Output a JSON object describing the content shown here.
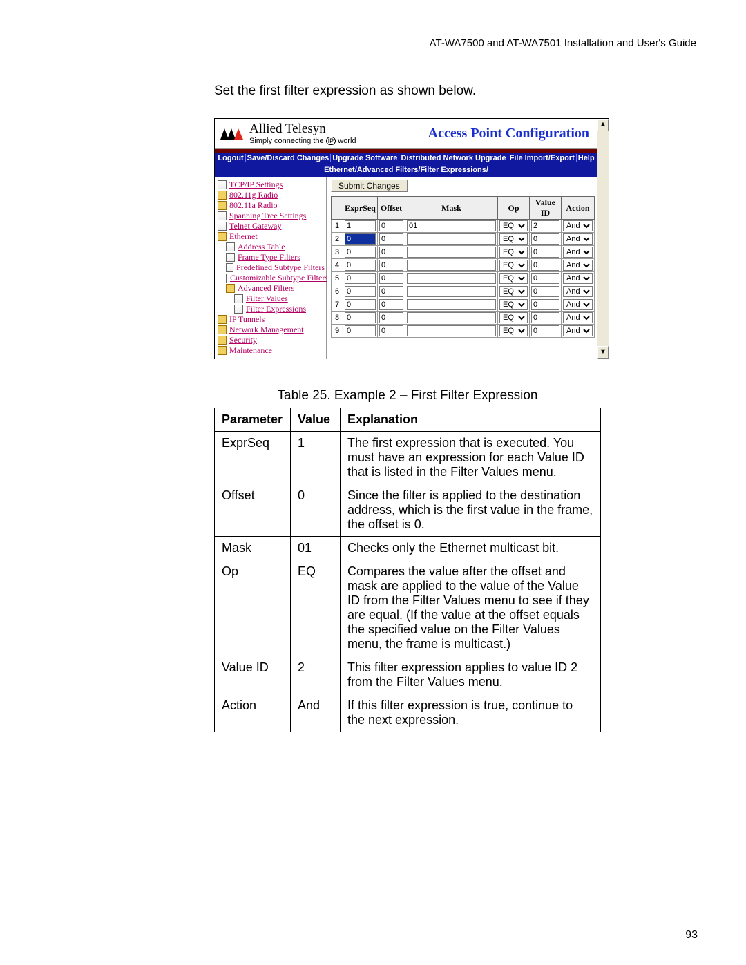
{
  "running_head": "AT-WA7500 and AT-WA7501 Installation and User's Guide",
  "intro": "Set the first filter expression as shown below.",
  "brand": {
    "name": "Allied Telesyn",
    "tagline_pre": "Simply connecting the ",
    "tagline_ip": "IP",
    "tagline_post": " world",
    "product": "Access Point Configuration"
  },
  "cmdbar": [
    "Logout",
    "Save/Discard Changes",
    "Upgrade Software",
    "Distributed Network Upgrade",
    "File Import/Export",
    "Help"
  ],
  "crumb": "Ethernet/Advanced Filters/Filter Expressions/",
  "nav": [
    {
      "ico": "doc",
      "lvl": 0,
      "label": "TCP/IP Settings"
    },
    {
      "ico": "fold",
      "lvl": 0,
      "label": "802.11g Radio"
    },
    {
      "ico": "fold",
      "lvl": 0,
      "label": "802.11a Radio"
    },
    {
      "ico": "doc",
      "lvl": 0,
      "label": "Spanning Tree Settings"
    },
    {
      "ico": "doc",
      "lvl": 0,
      "label": "Telnet Gateway"
    },
    {
      "ico": "fold",
      "lvl": 0,
      "label": "Ethernet"
    },
    {
      "ico": "doc",
      "lvl": 1,
      "label": "Address Table"
    },
    {
      "ico": "doc",
      "lvl": 1,
      "label": "Frame Type Filters"
    },
    {
      "ico": "doc",
      "lvl": 1,
      "label": "Predefined Subtype Filters"
    },
    {
      "ico": "doc",
      "lvl": 1,
      "label": "Customizable Subtype Filters"
    },
    {
      "ico": "fold",
      "lvl": 1,
      "label": "Advanced Filters"
    },
    {
      "ico": "doc",
      "lvl": 2,
      "label": "Filter Values"
    },
    {
      "ico": "doc",
      "lvl": 2,
      "label": "Filter Expressions"
    },
    {
      "ico": "fold",
      "lvl": 0,
      "label": "IP Tunnels"
    },
    {
      "ico": "fold",
      "lvl": 0,
      "label": "Network Management"
    },
    {
      "ico": "fold",
      "lvl": 0,
      "label": "Security"
    },
    {
      "ico": "fold",
      "lvl": 0,
      "label": "Maintenance"
    }
  ],
  "submit": "Submit Changes",
  "fx_headers": [
    "",
    "ExprSeq",
    "Offset",
    "Mask",
    "Op",
    "Value ID",
    "Action"
  ],
  "fx_rows": [
    {
      "n": "1",
      "exprseq": "1",
      "offset": "0",
      "mask": "01",
      "op": "EQ",
      "valueid": "2",
      "action": "And"
    },
    {
      "n": "2",
      "exprseq": "0",
      "offset": "0",
      "mask": "",
      "op": "EQ",
      "valueid": "0",
      "action": "And"
    },
    {
      "n": "3",
      "exprseq": "0",
      "offset": "0",
      "mask": "",
      "op": "EQ",
      "valueid": "0",
      "action": "And"
    },
    {
      "n": "4",
      "exprseq": "0",
      "offset": "0",
      "mask": "",
      "op": "EQ",
      "valueid": "0",
      "action": "And"
    },
    {
      "n": "5",
      "exprseq": "0",
      "offset": "0",
      "mask": "",
      "op": "EQ",
      "valueid": "0",
      "action": "And"
    },
    {
      "n": "6",
      "exprseq": "0",
      "offset": "0",
      "mask": "",
      "op": "EQ",
      "valueid": "0",
      "action": "And"
    },
    {
      "n": "7",
      "exprseq": "0",
      "offset": "0",
      "mask": "",
      "op": "EQ",
      "valueid": "0",
      "action": "And"
    },
    {
      "n": "8",
      "exprseq": "0",
      "offset": "0",
      "mask": "",
      "op": "EQ",
      "valueid": "0",
      "action": "And"
    },
    {
      "n": "9",
      "exprseq": "0",
      "offset": "0",
      "mask": "",
      "op": "EQ",
      "valueid": "0",
      "action": "And"
    }
  ],
  "caption": "Table 25. Example 2 – First Filter Expression",
  "expl_headers": {
    "p": "Parameter",
    "v": "Value",
    "e": "Explanation"
  },
  "expl_rows": [
    {
      "p": "ExprSeq",
      "v": "1",
      "e": "The first expression that is executed. You must have an expression for each Value ID that is listed in the Filter Values menu."
    },
    {
      "p": "Offset",
      "v": "0",
      "e": "Since the filter is applied to the destination address, which is the first value in the frame, the offset is 0."
    },
    {
      "p": "Mask",
      "v": "01",
      "e": "Checks only the Ethernet multicast bit."
    },
    {
      "p": "Op",
      "v": "EQ",
      "e": "Compares the value after the offset and mask are applied to the value of the Value ID from the Filter Values menu to see if they are equal. (If the value at the offset equals the specified value on the Filter Values menu, the frame is multicast.)"
    },
    {
      "p": "Value ID",
      "v": "2",
      "e": "This filter expression applies to value ID 2 from the Filter Values menu."
    },
    {
      "p": "Action",
      "v": "And",
      "e": "If this filter expression is true, continue to the next expression."
    }
  ],
  "pageno": "93"
}
